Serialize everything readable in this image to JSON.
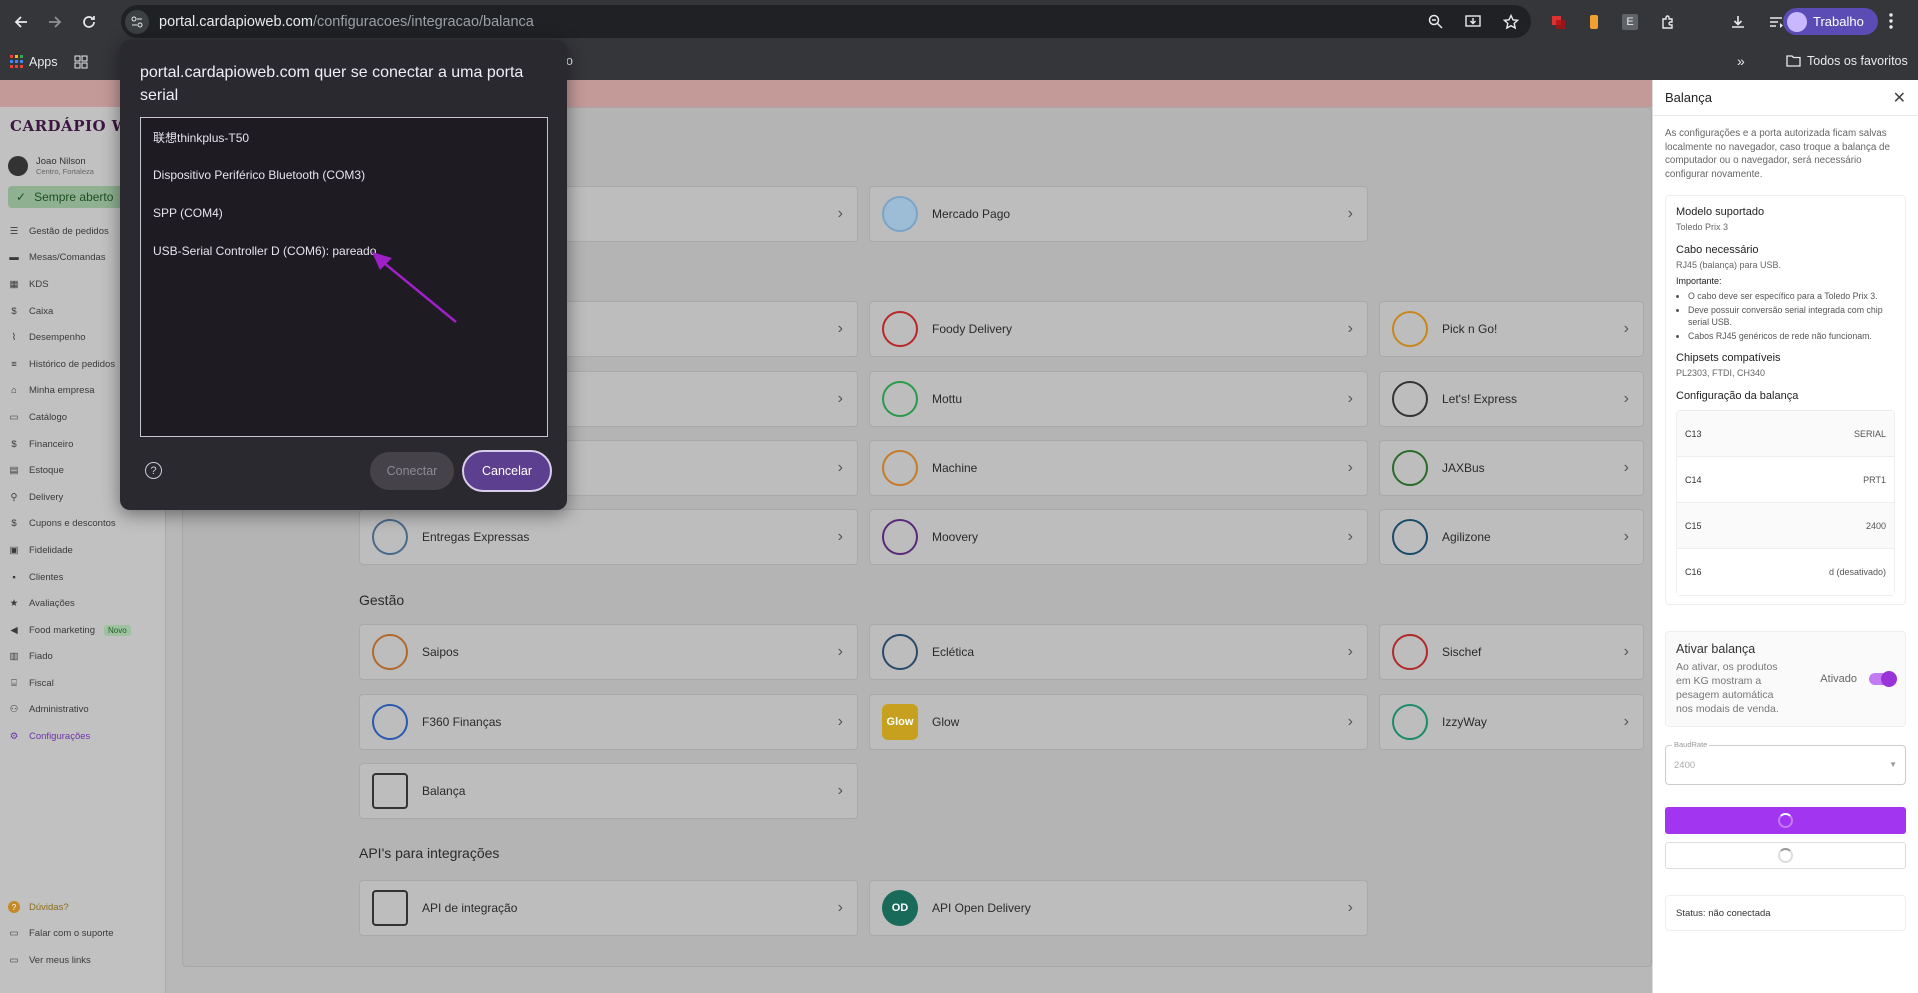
{
  "browser": {
    "url_host": "portal.cardapioweb.com",
    "url_path": "/configuracoes/integracao/balanca",
    "profile": "Trabalho",
    "ext_letter": "E",
    "bookmarks": {
      "apps": "Apps",
      "all": "Todos os favoritos",
      "partial": "o"
    }
  },
  "dialog": {
    "title": "portal.cardapioweb.com quer se conectar a uma porta serial",
    "devices": [
      "联想thinkplus-T50",
      "Dispositivo Periférico Bluetooth (COM3)",
      "SPP (COM4)",
      "USB-Serial Controller D (COM6): pareado"
    ],
    "help": "?",
    "connect": "Conectar",
    "cancel": "Cancelar"
  },
  "sidebar": {
    "logo": "CARDÁPIO WEB",
    "user_name": "Joao Nilson",
    "user_sub": "Centro, Fortaleza",
    "status": "Sempre aberto",
    "items": [
      {
        "label": "Gestão de pedidos",
        "icon": "list-icon"
      },
      {
        "label": "Mesas/Comandas",
        "icon": "table-icon"
      },
      {
        "label": "KDS",
        "icon": "grid-icon"
      },
      {
        "label": "Caixa",
        "icon": "dollar-icon"
      },
      {
        "label": "Desempenho",
        "icon": "chart-icon"
      },
      {
        "label": "Histórico de pedidos",
        "icon": "history-icon"
      },
      {
        "label": "Minha empresa",
        "icon": "store-icon"
      },
      {
        "label": "Catálogo",
        "icon": "book-icon"
      },
      {
        "label": "Financeiro",
        "icon": "money-icon"
      },
      {
        "label": "Estoque",
        "icon": "box-icon"
      },
      {
        "label": "Delivery",
        "icon": "bike-icon"
      },
      {
        "label": "Cupons e descontos",
        "icon": "coupon-icon"
      },
      {
        "label": "Fidelidade",
        "icon": "gift-icon"
      },
      {
        "label": "Clientes",
        "icon": "person-icon"
      },
      {
        "label": "Avaliações",
        "icon": "star-icon"
      },
      {
        "label": "Food marketing",
        "icon": "megaphone-icon",
        "badge": "Novo"
      },
      {
        "label": "Fiado",
        "icon": "notebook-icon"
      },
      {
        "label": "Fiscal",
        "icon": "bank-icon"
      },
      {
        "label": "Administrativo",
        "icon": "people-icon"
      },
      {
        "label": "Configurações",
        "icon": "gear-icon"
      }
    ],
    "bottom": [
      {
        "label": "Dúvidas?",
        "icon": "question-icon"
      },
      {
        "label": "Falar com o suporte",
        "icon": "chat-icon"
      },
      {
        "label": "Ver meus links",
        "icon": "link-icon"
      }
    ]
  },
  "content": {
    "sections": {
      "gestao": "Gestão",
      "api": "API's para integrações"
    },
    "cards": {
      "mercado_pago": "Mercado Pago",
      "foody": "Foody Delivery",
      "pickngo": "Pick n Go!",
      "mottu": "Mottu",
      "lets": "Let's! Express",
      "machine": "Machine",
      "jaxbus": "JAXBus",
      "entregas": "Entregas Expressas",
      "moovery": "Moovery",
      "agilizone": "Agilizone",
      "saipos": "Saipos",
      "ecletica": "Eclética",
      "sischef": "Sischef",
      "f360": "F360 Finanças",
      "glow": "Glow",
      "izzyway": "IzzyWay",
      "balanca": "Balança",
      "api_integracao": "API de integração",
      "api_open": "API Open Delivery"
    },
    "logo_text": {
      "glow": "Glow",
      "open": "OD"
    }
  },
  "drawer": {
    "title": "Balança",
    "intro": "As configurações e a porta autorizada ficam salvas localmente no navegador, caso troque a balança de computador ou o navegador, será necessário configurar novamente.",
    "model_h": "Modelo suportado",
    "model_v": "Toledo Prix 3",
    "cable_h": "Cabo necessário",
    "cable_v": "RJ45 (balança) para USB.",
    "important": "Importante:",
    "bullets": [
      "O cabo deve ser específico para a Toledo Prix 3.",
      "Deve possuir conversão serial integrada com chip serial USB.",
      "Cabos RJ45 genéricos de rede não funcionam."
    ],
    "chipsets_h": "Chipsets compatíveis",
    "chipsets_v": "PL2303, FTDI, CH340",
    "config_h": "Configuração da balança",
    "config": [
      {
        "k": "C13",
        "v": "SERIAL"
      },
      {
        "k": "C14",
        "v": "PRT1"
      },
      {
        "k": "C15",
        "v": "2400"
      },
      {
        "k": "C16",
        "v": "d (desativado)"
      }
    ],
    "ativar_t": "Ativar balança",
    "ativar_d": "Ao ativar, os produtos em KG mostram a pesagem automática nos modais de venda.",
    "ativado": "Ativado",
    "baud_label": "BaudRate",
    "baud_value": "2400",
    "status": "Status: não conectada"
  },
  "colors": {
    "accent": "#a235f0",
    "dialog_bg": "#2b2930",
    "cancel_bg": "#5c3f8e",
    "arrow": "#a020c8"
  }
}
